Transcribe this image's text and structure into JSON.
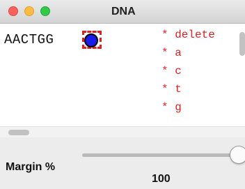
{
  "window": {
    "title": "DNA"
  },
  "editor": {
    "sequence": "AACTGG",
    "menu_items": [
      "* delete",
      "* a",
      "* c",
      "* t",
      "* g"
    ]
  },
  "controls": {
    "margin_label": "Margin %",
    "margin_value": "100"
  },
  "colors": {
    "sequence_text": "#111111",
    "menu_text": "#e02020",
    "cursor_fill": "#1a1aee",
    "cursor_outline": "#e02020"
  }
}
